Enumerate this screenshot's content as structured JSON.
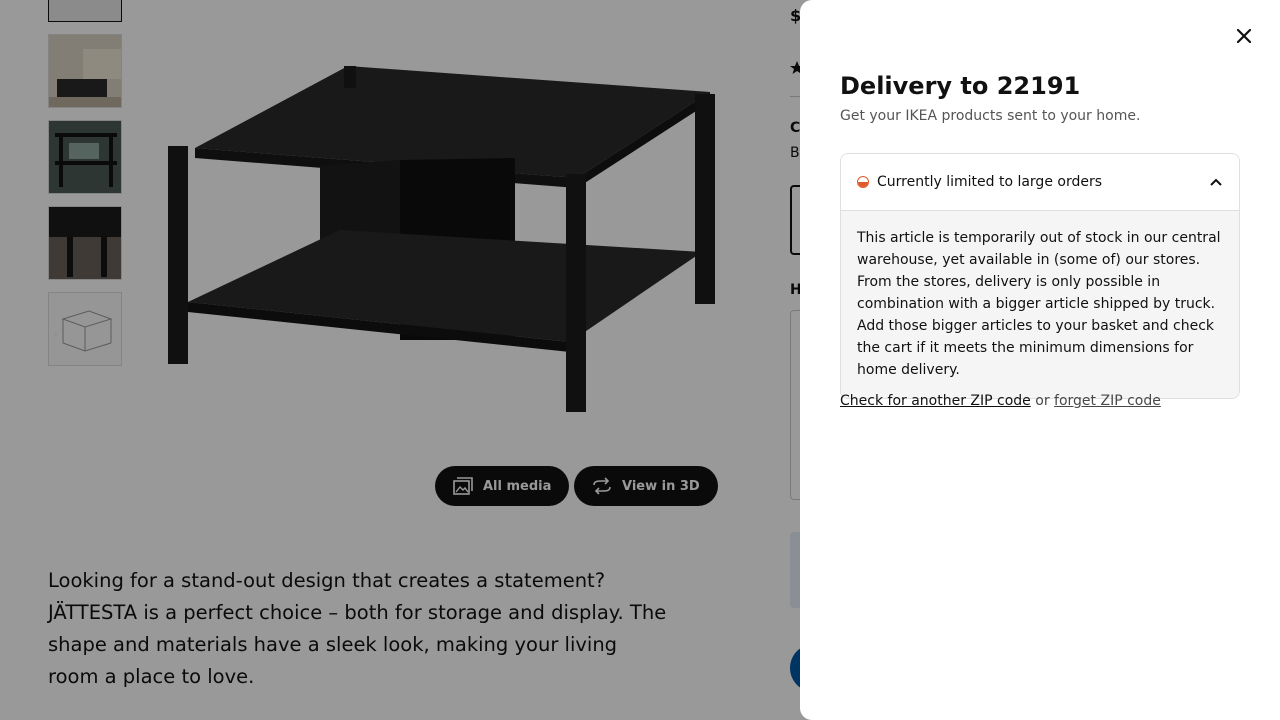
{
  "product": {
    "price_prefix": "$",
    "section_c": "C",
    "section_b": "B",
    "section_h": "H",
    "media_buttons": {
      "all_media": "All media",
      "view_3d": "View in 3D"
    },
    "description": "Looking for a stand-out design that creates a statement? JÄTTESTA is a perfect choice – both for storage and display. The shape and materials have a sleek look, making your living room a place to love."
  },
  "delivery_modal": {
    "title": "Delivery to 22191",
    "subtitle": "Get your IKEA products sent to your home.",
    "status": {
      "label": "Currently limited to large orders",
      "color": "#e0592a",
      "body": "This article is temporarily out of stock in our central warehouse, yet available in (some of) our stores. From the stores, delivery is only possible in combination with a bigger article shipped by truck. Add those bigger articles to your basket and check the cart if it meets the minimum dimensions for home delivery."
    },
    "links": {
      "check_another": "Check for another ZIP code",
      "separator": "or",
      "forget": "forget ZIP code"
    }
  },
  "icons": {
    "close": "close-icon",
    "chevron": "chevron-up-icon",
    "media": "image-gallery-icon",
    "rotate": "rotate-3d-icon"
  },
  "colors": {
    "accent_blue": "#0058a3",
    "status_orange": "#e0592a"
  }
}
